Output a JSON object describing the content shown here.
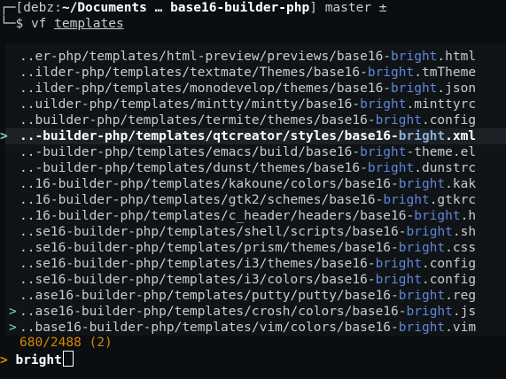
{
  "prompt": {
    "corner_top": "┌─",
    "open_bracket": "[",
    "user": "debz",
    "colon": ":",
    "path": "~/Documents … base16-builder-php",
    "close_bracket": "]",
    "branch": "master ±",
    "corner_bottom": "└─",
    "symbol": "$",
    "command": "vf",
    "argument": "templates"
  },
  "colors": {
    "background": "#0b0e11",
    "panel": "#111417",
    "match_highlight": "#5f87d7",
    "info": "#d78700",
    "marker": "#87d7af"
  },
  "results": [
    {
      "pre": "..er-php/templates/html-preview/previews/base16-",
      "match": "bright",
      "post": ".html",
      "marked": false,
      "selected": false
    },
    {
      "pre": "..ilder-php/templates/textmate/Themes/base16-",
      "match": "bright",
      "post": ".tmTheme",
      "marked": false,
      "selected": false
    },
    {
      "pre": "..ilder-php/templates/monodevelop/themes/base16-",
      "match": "bright",
      "post": ".json",
      "marked": false,
      "selected": false
    },
    {
      "pre": "..uilder-php/templates/mintty/mintty/base16-",
      "match": "bright",
      "post": ".minttyrc",
      "marked": false,
      "selected": false
    },
    {
      "pre": "..builder-php/templates/termite/themes/base16-",
      "match": "bright",
      "post": ".config",
      "marked": false,
      "selected": false
    },
    {
      "pre": "..-builder-php/templates/qtcreator/styles/base16-",
      "match": "bright",
      "post": ".xml",
      "marked": false,
      "selected": true
    },
    {
      "pre": "..-builder-php/templates/emacs/build/base16-",
      "match": "bright",
      "post": "-theme.el",
      "marked": false,
      "selected": false
    },
    {
      "pre": "..-builder-php/templates/dunst/themes/base16-",
      "match": "bright",
      "post": ".dunstrc",
      "marked": false,
      "selected": false
    },
    {
      "pre": "..16-builder-php/templates/kakoune/colors/base16-",
      "match": "bright",
      "post": ".kak",
      "marked": false,
      "selected": false
    },
    {
      "pre": "..16-builder-php/templates/gtk2/schemes/base16-",
      "match": "bright",
      "post": ".gtkrc",
      "marked": false,
      "selected": false
    },
    {
      "pre": "..16-builder-php/templates/c_header/headers/base16-",
      "match": "bright",
      "post": ".h",
      "marked": false,
      "selected": false
    },
    {
      "pre": "..se16-builder-php/templates/shell/scripts/base16-",
      "match": "bright",
      "post": ".sh",
      "marked": false,
      "selected": false
    },
    {
      "pre": "..se16-builder-php/templates/prism/themes/base16-",
      "match": "bright",
      "post": ".css",
      "marked": false,
      "selected": false
    },
    {
      "pre": "..se16-builder-php/templates/i3/themes/base16-",
      "match": "bright",
      "post": ".config",
      "marked": false,
      "selected": false
    },
    {
      "pre": "..se16-builder-php/templates/i3/colors/base16-",
      "match": "bright",
      "post": ".config",
      "marked": false,
      "selected": false
    },
    {
      "pre": "..ase16-builder-php/templates/putty/putty/base16-",
      "match": "bright",
      "post": ".reg",
      "marked": false,
      "selected": false
    },
    {
      "pre": "..ase16-builder-php/templates/crosh/colors/base16-",
      "match": "bright",
      "post": ".js",
      "marked": true,
      "selected": false
    },
    {
      "pre": "..base16-builder-php/templates/vim/colors/base16-",
      "match": "bright",
      "post": ".vim",
      "marked": true,
      "selected": false
    }
  ],
  "selection_pointer": ">",
  "multi_marker": ">",
  "info": "680/2488 (2)",
  "query": {
    "prompt": ">",
    "text": "bright"
  }
}
